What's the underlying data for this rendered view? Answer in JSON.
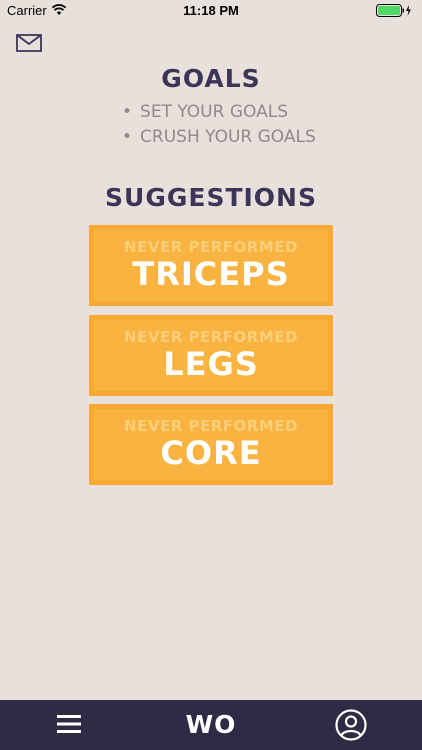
{
  "status_bar": {
    "carrier": "Carrier",
    "time": "11:18 PM"
  },
  "icons": {
    "mail": "mail-icon",
    "wifi": "wifi-icon",
    "battery": "battery-icon",
    "menu": "menu-icon",
    "profile": "profile-icon"
  },
  "goals": {
    "title": "GOALS",
    "items": [
      "SET YOUR GOALS",
      "CRUSH YOUR GOALS"
    ]
  },
  "suggestions": {
    "title": "SUGGESTIONS",
    "cards": [
      {
        "subtitle": "NEVER PERFORMED",
        "label": "TRICEPS"
      },
      {
        "subtitle": "NEVER PERFORMED",
        "label": "LEGS"
      },
      {
        "subtitle": "NEVER PERFORMED",
        "label": "CORE"
      }
    ]
  },
  "tab_bar": {
    "logo": "WO"
  },
  "colors": {
    "background": "#e8e0da",
    "heading": "#3b3658",
    "card": "#f7a934",
    "tab_bar": "#302b45"
  }
}
